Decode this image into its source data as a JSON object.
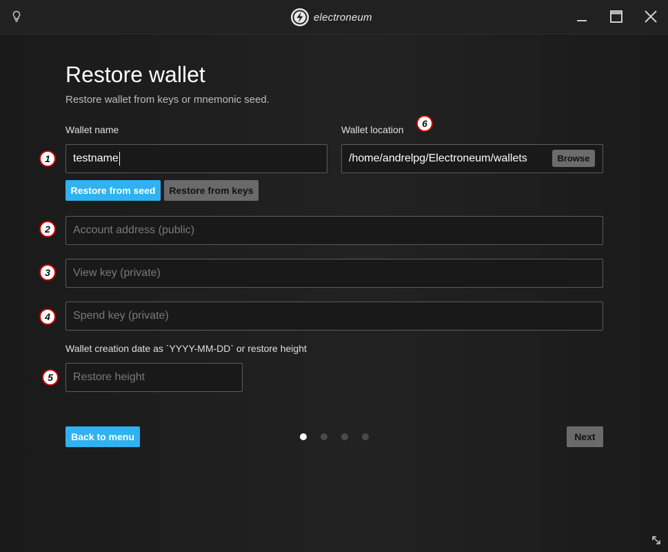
{
  "window": {
    "brand": "electroneum",
    "icons": [
      "lightbulb-icon",
      "electroneum-logo-icon",
      "minimize-icon",
      "maximize-icon",
      "close-icon",
      "resize-icon"
    ]
  },
  "page": {
    "title": "Restore wallet",
    "subtitle": "Restore wallet from keys or mnemonic seed."
  },
  "form": {
    "wallet_name_label": "Wallet name",
    "wallet_name_value": "testname",
    "wallet_location_label": "Wallet location",
    "wallet_location_value": "/home/andrelpg/Electroneum/wallets",
    "browse_label": "Browse",
    "restore_from_seed_label": "Restore from seed",
    "restore_from_keys_label": "Restore from keys",
    "account_address_placeholder": "Account address (public)",
    "view_key_placeholder": "View key (private)",
    "spend_key_placeholder": "Spend key (private)",
    "creation_date_label": "Wallet creation date as `YYYY-MM-DD` or restore height",
    "restore_height_placeholder": "Restore height"
  },
  "navigation": {
    "back_label": "Back to menu",
    "next_label": "Next",
    "steps_total": 4,
    "current_step": 1
  },
  "markers": [
    "1",
    "2",
    "3",
    "4",
    "5",
    "6"
  ],
  "colors": {
    "accent": "#2fb2f2",
    "marker_border": "#d40000",
    "background": "#1b1b1b"
  }
}
